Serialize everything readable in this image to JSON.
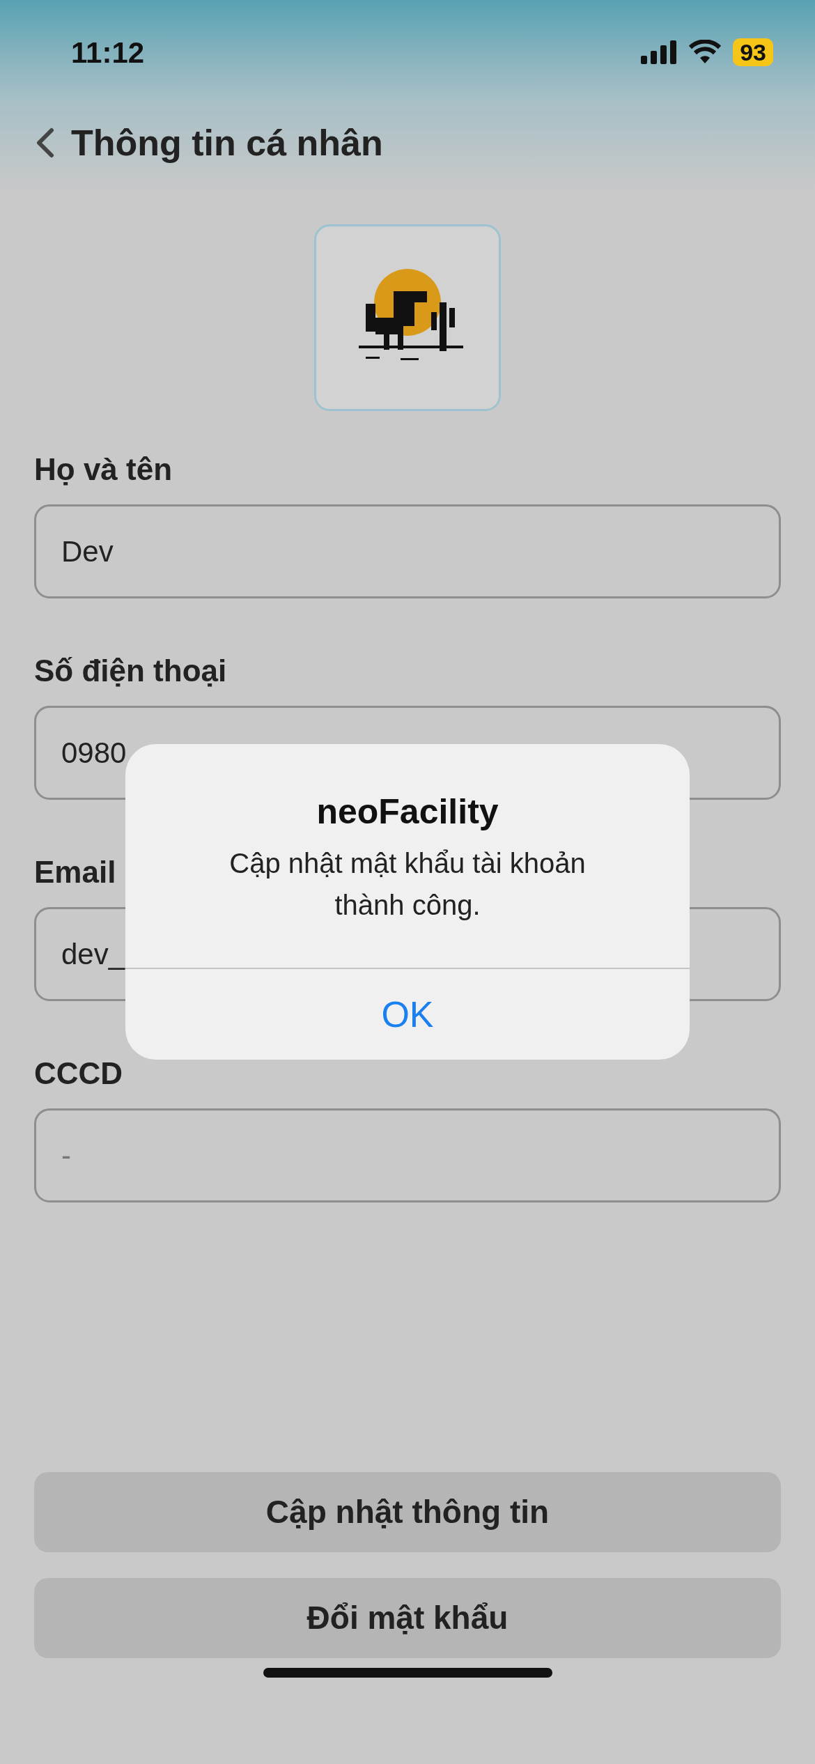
{
  "status_bar": {
    "time": "11:12",
    "battery": "93"
  },
  "header": {
    "title": "Thông tin cá nhân"
  },
  "fields": [
    {
      "label": "Họ và tên",
      "value": "Dev"
    },
    {
      "label": "Số điện thoại",
      "value": "0980"
    },
    {
      "label": "Email",
      "value": "dev_"
    },
    {
      "label": "CCCD",
      "placeholder": "-"
    }
  ],
  "buttons": [
    "Cập nhật thông tin",
    "Đổi mật khẩu"
  ],
  "alert": {
    "title": "neoFacility",
    "message": "Cập nhật mật khẩu tài khoản thành công.",
    "button": "OK"
  }
}
